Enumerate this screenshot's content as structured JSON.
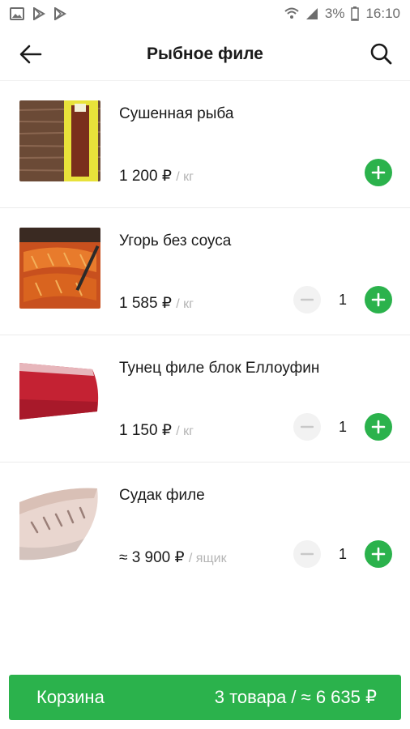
{
  "status_bar": {
    "battery": "3%",
    "time": "16:10",
    "icons": [
      "image-icon",
      "play-store-icon",
      "play-store-icon",
      "wifi-icon",
      "signal-icon",
      "battery-icon"
    ]
  },
  "header": {
    "title": "Рыбное филе",
    "back_icon": "arrow-left-icon",
    "search_icon": "search-icon"
  },
  "products": [
    {
      "name": "Сушенная рыба",
      "price": "1 200 ₽",
      "unit": "/ кг",
      "quantity": null
    },
    {
      "name": "Угорь без соуса",
      "price": "1 585 ₽",
      "unit": "/ кг",
      "quantity": "1"
    },
    {
      "name": "Тунец филе блок Еллоуфин",
      "price": "1 150 ₽",
      "unit": "/ кг",
      "quantity": "1"
    },
    {
      "name": "Судак филе",
      "price": "≈ 3 900 ₽",
      "unit": "/ ящик",
      "quantity": "1"
    }
  ],
  "cart": {
    "label": "Корзина",
    "summary": "3 товара / ≈ 6 635 ₽"
  },
  "colors": {
    "accent": "#2bb24c",
    "unit_text": "#b5b5b5",
    "minus_bg": "#f2f2f2"
  }
}
